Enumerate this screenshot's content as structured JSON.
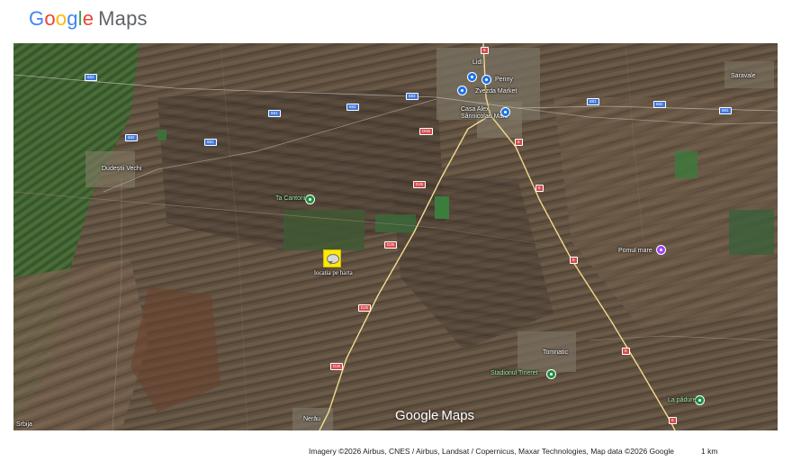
{
  "header": {
    "logo_google": [
      "G",
      "o",
      "o",
      "g",
      "l",
      "e"
    ],
    "logo_maps": "Maps"
  },
  "map": {
    "watermark_google": "Google",
    "watermark_maps": "Maps",
    "imagery": "satellite",
    "places": [
      {
        "name": "Dudeștii Vechi",
        "kind": "town"
      },
      {
        "name": "Lidl",
        "kind": "town"
      },
      {
        "name": "Penny",
        "kind": "town"
      },
      {
        "name": "Zvezda Market",
        "kind": "town"
      },
      {
        "name": "Casa Alex Sânnicolau Mare",
        "kind": "town"
      },
      {
        "name": "Saravale",
        "kind": "town"
      },
      {
        "name": "Tomnatic",
        "kind": "town"
      },
      {
        "name": "Nerău",
        "kind": "town"
      },
      {
        "name": "Pomul mare",
        "kind": "town"
      },
      {
        "name": "Srbija",
        "kind": "town"
      }
    ],
    "markers": [
      {
        "label": "Ta Cantoni",
        "color": "#1e8e3e"
      },
      {
        "label": "Pomul mare",
        "color": "#a142f4"
      },
      {
        "label": "Stadionul Tineret",
        "color": "#1e8e3e"
      },
      {
        "label": "La pădure",
        "color": "#1e8e3e"
      },
      {
        "label": "Penny",
        "color": "#1a73e8"
      },
      {
        "label": "Lidl",
        "color": "#1a73e8"
      },
      {
        "label": "Zvezda Market",
        "color": "#1a73e8"
      },
      {
        "label": "Casa Alex",
        "color": "#1a73e8"
      }
    ],
    "road_shields": [
      {
        "text": "DN6",
        "color": "red"
      },
      {
        "text": "DJ6",
        "color": "red"
      },
      {
        "text": "682",
        "color": "blue"
      },
      {
        "text": "681",
        "color": "blue"
      },
      {
        "text": "682",
        "color": "blue"
      },
      {
        "text": "683",
        "color": "blue"
      },
      {
        "text": "681",
        "color": "blue"
      },
      {
        "text": "DJ6",
        "color": "red"
      },
      {
        "text": "6",
        "color": "red"
      },
      {
        "text": "6",
        "color": "red"
      },
      {
        "text": "6",
        "color": "red"
      },
      {
        "text": "6",
        "color": "red"
      },
      {
        "text": "6",
        "color": "red"
      },
      {
        "text": "682",
        "color": "blue"
      },
      {
        "text": "681",
        "color": "blue"
      },
      {
        "text": "682",
        "color": "blue"
      },
      {
        "text": "681",
        "color": "blue"
      },
      {
        "text": "DJ6",
        "color": "red"
      },
      {
        "text": "DJ6",
        "color": "red"
      },
      {
        "text": "6",
        "color": "red"
      }
    ],
    "custom_marker_label": "locatia pe harta"
  },
  "footer": {
    "attribution": "Imagery ©2026 Airbus, CNES / Airbus, Landsat / Copernicus, Maxar Technologies, Map data ©2026 Google",
    "scale_label": "1 km"
  }
}
